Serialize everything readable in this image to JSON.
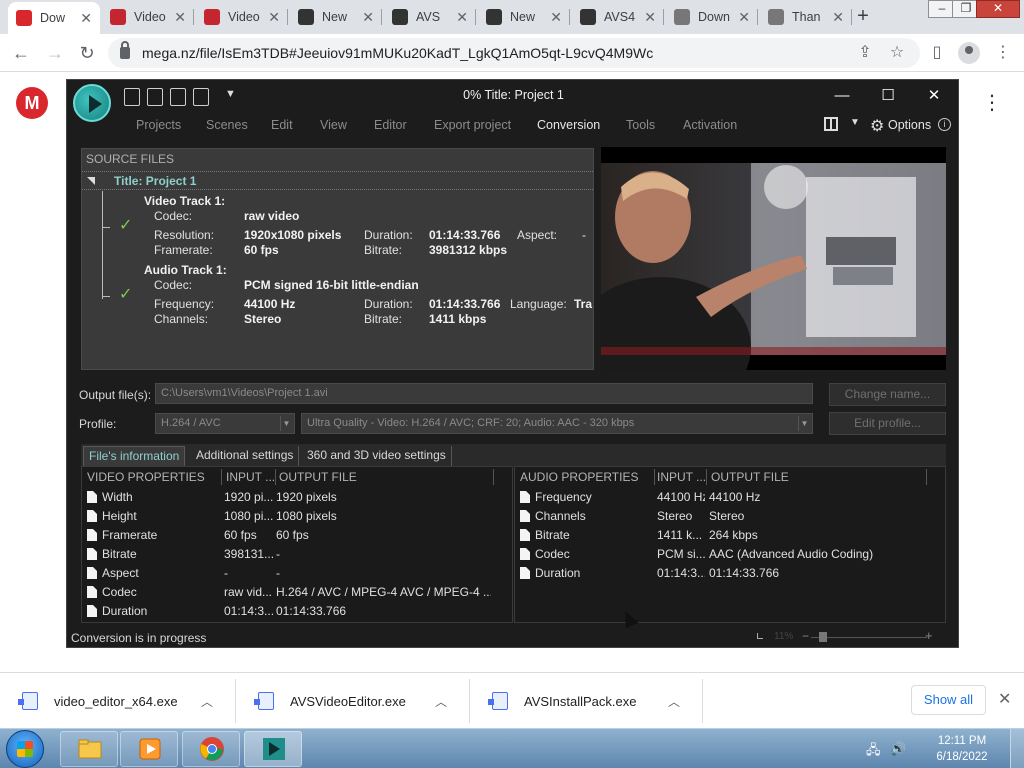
{
  "browser": {
    "tabs": [
      {
        "label": "Dow",
        "icon": "mega-icon",
        "color": "#d9272e",
        "active": true
      },
      {
        "label": "Video",
        "icon": "nch-icon",
        "color": "#c3262e"
      },
      {
        "label": "Video",
        "icon": "nch-icon",
        "color": "#c3262e"
      },
      {
        "label": "New",
        "icon": "github-icon",
        "color": "#333333"
      },
      {
        "label": "AVS",
        "icon": "avs-icon",
        "color": "#333333"
      },
      {
        "label": "New",
        "icon": "github-icon",
        "color": "#333333"
      },
      {
        "label": "AVS4",
        "icon": "avs-icon",
        "color": "#333333"
      },
      {
        "label": "Down",
        "icon": "download-icon",
        "color": "#777777"
      },
      {
        "label": "Than",
        "icon": "download-icon",
        "color": "#777777"
      }
    ],
    "url": "mega.nz/file/IsEm3TDB#Jeeuiov91mMUKu20KadT_LgkQ1AmO5qt-L9cvQ4M9Wc"
  },
  "avs": {
    "window_title": "0% Title: Project 1",
    "menu": [
      "Projects",
      "Scenes",
      "Edit",
      "View",
      "Editor",
      "Export project",
      "Conversion",
      "Tools",
      "Activation"
    ],
    "active_menu": "Conversion",
    "options_label": "Options",
    "source": {
      "header": "SOURCE FILES",
      "title": "Title: Project 1",
      "video_track": {
        "name": "Video Track 1:",
        "codec_label": "Codec:",
        "codec": "raw video",
        "resolution_label": "Resolution:",
        "resolution": "1920x1080 pixels",
        "framerate_label": "Framerate:",
        "framerate": "60 fps",
        "duration_label": "Duration:",
        "duration": "01:14:33.766",
        "bitrate_label": "Bitrate:",
        "bitrate": "3981312 kbps",
        "aspect_label": "Aspect:",
        "aspect": "-"
      },
      "audio_track": {
        "name": "Audio Track 1:",
        "codec_label": "Codec:",
        "codec": "PCM signed 16-bit little-endian",
        "frequency_label": "Frequency:",
        "frequency": "44100 Hz",
        "channels_label": "Channels:",
        "channels": "Stereo",
        "duration_label": "Duration:",
        "duration": "01:14:33.766",
        "bitrate_label": "Bitrate:",
        "bitrate": "1411 kbps",
        "language_label": "Language:",
        "language": "Tra"
      }
    },
    "output": {
      "label": "Output file(s):",
      "value": "C:\\Users\\vm1\\Videos\\Project 1.avi",
      "change_button": "Change name..."
    },
    "profile": {
      "label": "Profile:",
      "format": "H.264 / AVC",
      "preset": "Ultra Quality - Video: H.264 / AVC; CRF: 20; Audio: AAC - 320 kbps",
      "edit_button": "Edit profile..."
    },
    "info_tabs": [
      "File's information",
      "Additional settings",
      "360 and 3D video settings"
    ],
    "video_props": {
      "headers": [
        "VIDEO PROPERTIES",
        "INPUT ...",
        "OUTPUT FILE"
      ],
      "rows": [
        [
          "Width",
          "1920 pi...",
          "1920 pixels"
        ],
        [
          "Height",
          "1080 pi...",
          "1080 pixels"
        ],
        [
          "Framerate",
          "60 fps",
          "60 fps"
        ],
        [
          "Bitrate",
          "398131...",
          "-"
        ],
        [
          "Aspect",
          "-",
          "-"
        ],
        [
          "Codec",
          "raw vid...",
          "H.264 / AVC / MPEG-4 AVC / MPEG-4 ..."
        ],
        [
          "Duration",
          "01:14:3...",
          "01:14:33.766"
        ]
      ]
    },
    "audio_props": {
      "headers": [
        "AUDIO PROPERTIES",
        "INPUT ...",
        "OUTPUT FILE"
      ],
      "rows": [
        [
          "Frequency",
          "44100 Hz",
          "44100 Hz"
        ],
        [
          "Channels",
          "Stereo",
          "Stereo"
        ],
        [
          "Bitrate",
          "1411 k...",
          "264 kbps"
        ],
        [
          "Codec",
          "PCM si...",
          "AAC (Advanced Audio Coding)"
        ],
        [
          "Duration",
          "01:14:3...",
          "01:14:33.766"
        ]
      ]
    },
    "status": "Conversion is in progress",
    "zoom": "11%"
  },
  "downloads": {
    "items": [
      "video_editor_x64.exe",
      "AVSVideoEditor.exe",
      "AVSInstallPack.exe"
    ],
    "show_all": "Show all"
  },
  "taskbar": {
    "time": "12:11 PM",
    "date": "6/18/2022"
  }
}
